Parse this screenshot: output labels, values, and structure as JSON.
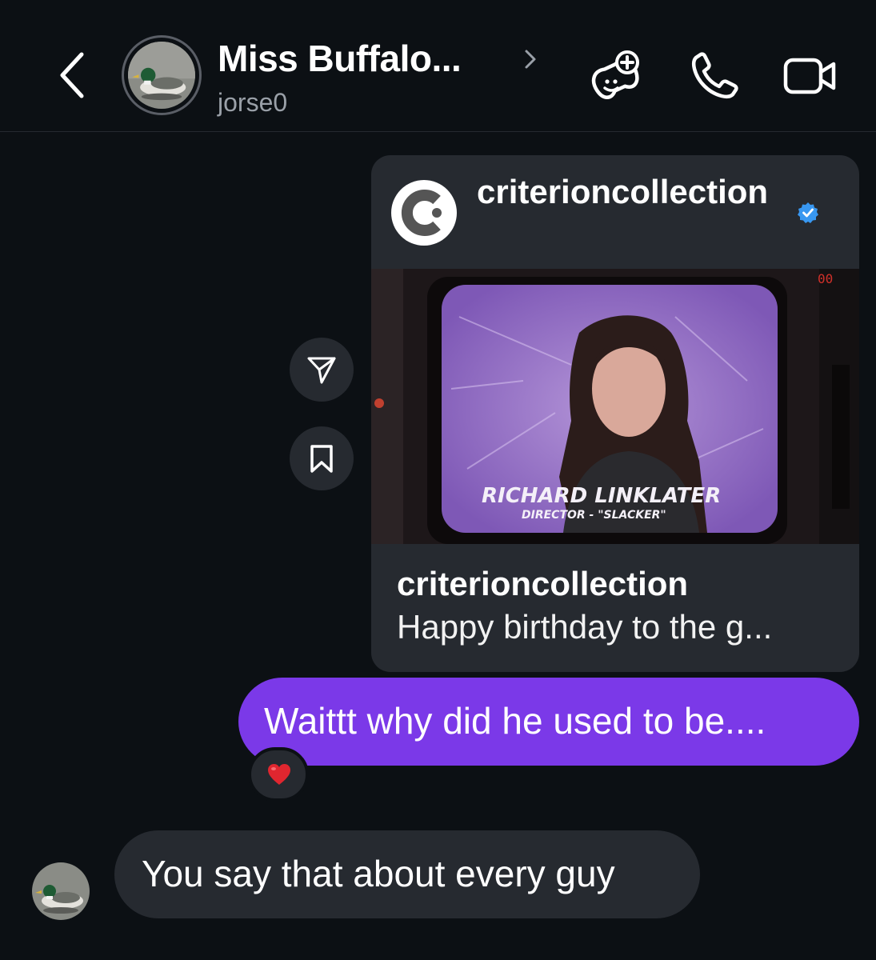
{
  "header": {
    "contact_name": "Miss Buffalo...",
    "username": "jorse0",
    "icons": [
      "back-chevron-icon",
      "chevron-right-icon",
      "game-controller-add-icon",
      "phone-icon",
      "video-camera-icon"
    ]
  },
  "shared_post": {
    "account_header": "criterioncollection",
    "verified": true,
    "image_caption_overlay": {
      "name": "RICHARD LINKLATER",
      "subtitle": "DIRECTOR - \"SLACKER\"",
      "corner_counter": "00"
    },
    "caption_user": "criterioncollection",
    "caption_text": "Happy birthday to the g..."
  },
  "messages": [
    {
      "direction": "outgoing",
      "text": "Waittt why did he used to be....",
      "reaction": "❤️"
    },
    {
      "direction": "incoming",
      "text": "You say that about every guy"
    }
  ],
  "colors": {
    "background": "#0c1014",
    "bubble_incoming": "#262a30",
    "bubble_outgoing": "#7b39e8",
    "verified_blue": "#3897f0",
    "muted_text": "#9aa0a8"
  }
}
